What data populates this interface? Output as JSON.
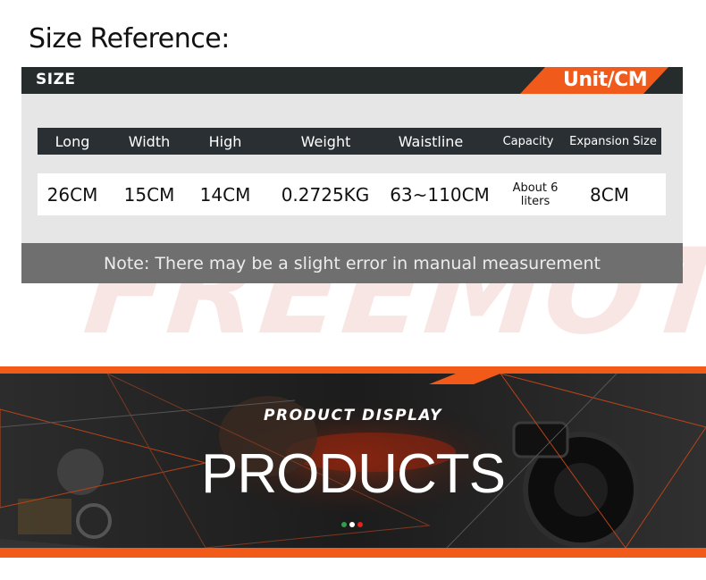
{
  "page": {
    "heading": "Size Reference:",
    "watermark": "FREEMOTO"
  },
  "size_table": {
    "title": "SIZE",
    "unit": "Unit/CM",
    "headers": [
      "Long",
      "Width",
      "High",
      "Weight",
      "Waistline",
      "Capacity",
      "Expansion Size"
    ],
    "values": [
      "26CM",
      "15CM",
      "14CM",
      "0.2725KG",
      "63~110CM",
      "About 6\nliters",
      "8CM"
    ],
    "note": "Note: There may be a slight error in manual measurement"
  },
  "banner": {
    "subtitle": "PRODUCT DISPLAY",
    "title": "PRODUCTS",
    "dots": [
      "#2f9e46",
      "#ffffff",
      "#e2231a"
    ]
  },
  "colors": {
    "accent": "#f05a1a",
    "header_dark": "#262b2c",
    "card_bg": "#e6e6e6"
  }
}
